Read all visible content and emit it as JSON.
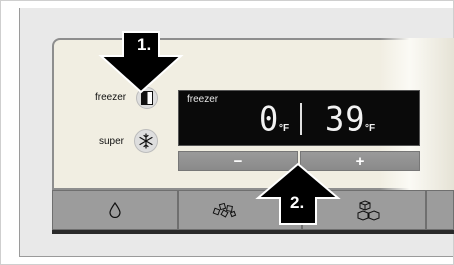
{
  "callouts": {
    "one": "1.",
    "two": "2."
  },
  "controls": {
    "freezer_label": "freezer",
    "super_label": "super"
  },
  "display": {
    "label": "freezer",
    "left_value": "0",
    "left_unit": "°F",
    "right_value": "39",
    "right_unit": "°F"
  },
  "adjust": {
    "minus_label": "−",
    "plus_label": "+"
  },
  "bottom_buttons": [
    {
      "icon": "water-drop-icon"
    },
    {
      "icon": "crushed-ice-icon"
    },
    {
      "icon": "ice-cubes-icon"
    }
  ],
  "colors": {
    "display_bg": "#0a0a0a",
    "button_grey": "#9a9a9a",
    "panel_bg": "#f1eee2",
    "arrow": "#000000"
  }
}
